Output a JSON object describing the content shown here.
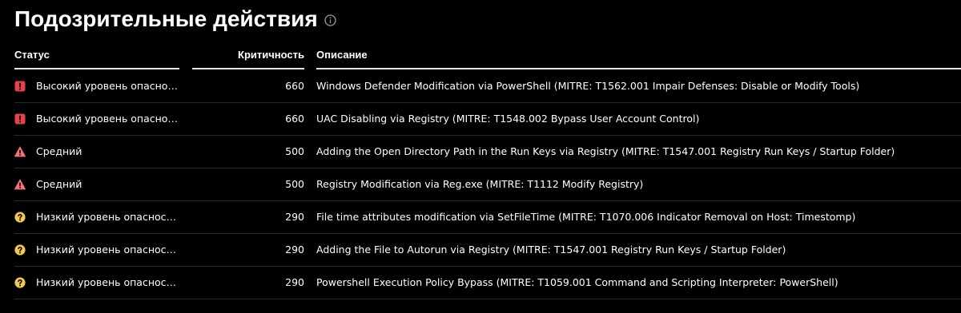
{
  "title": "Подозрительные действия",
  "columns": {
    "status": "Статус",
    "criticality": "Критичность",
    "description": "Описание"
  },
  "colors": {
    "high": "#e5414b",
    "medium": "#f07377",
    "low": "#f2c94c"
  },
  "rows": [
    {
      "severity": "high",
      "icon": "exclamation-square-icon",
      "status": "Высокий уровень опасно…",
      "criticality": "660",
      "description": "Windows Defender Modification via PowerShell (MITRE: T1562.001 Impair Defenses: Disable or Modify Tools)"
    },
    {
      "severity": "high",
      "icon": "exclamation-square-icon",
      "status": "Высокий уровень опасно…",
      "criticality": "660",
      "description": "UAC Disabling via Registry (MITRE: T1548.002 Bypass User Account Control)"
    },
    {
      "severity": "medium",
      "icon": "warning-triangle-icon",
      "status": "Средний",
      "criticality": "500",
      "description": "Adding the Open Directory Path in the Run Keys via Registry (MITRE: T1547.001 Registry Run Keys / Startup Folder)"
    },
    {
      "severity": "medium",
      "icon": "warning-triangle-icon",
      "status": "Средний",
      "criticality": "500",
      "description": "Registry Modification via Reg.exe (MITRE: T1112 Modify Registry)"
    },
    {
      "severity": "low",
      "icon": "question-circle-icon",
      "status": "Низкий уровень опаснос…",
      "criticality": "290",
      "description": "File time attributes modification via SetFileTime (MITRE: T1070.006 Indicator Removal on Host: Timestomp)"
    },
    {
      "severity": "low",
      "icon": "question-circle-icon",
      "status": "Низкий уровень опаснос…",
      "criticality": "290",
      "description": "Adding the File to Autorun via Registry (MITRE: T1547.001 Registry Run Keys / Startup Folder)"
    },
    {
      "severity": "low",
      "icon": "question-circle-icon",
      "status": "Низкий уровень опаснос…",
      "criticality": "290",
      "description": "Powershell Execution Policy Bypass (MITRE: T1059.001 Command and Scripting Interpreter: PowerShell)"
    }
  ]
}
